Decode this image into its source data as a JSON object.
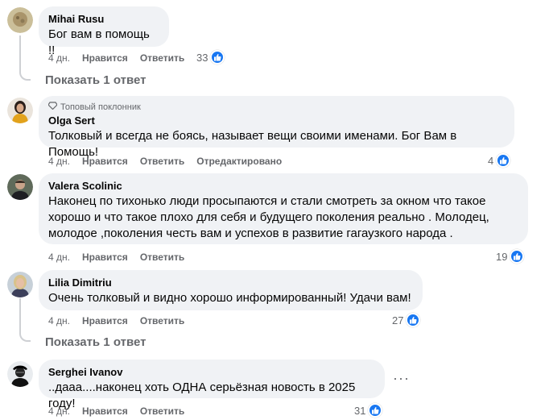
{
  "comments": [
    {
      "author": "Mihai Rusu",
      "text": "Бог вам в помощь !!",
      "time": "4 дн.",
      "like_label": "Нравится",
      "reply_label": "Ответить",
      "reactions": "33",
      "show_replies": "Показать 1 ответ"
    },
    {
      "badge": "Топовый поклонник",
      "author": "Olga Sert",
      "text": "Толковый и всегда не боясь, называет вещи своими именами. Бог Вам в Помощь!",
      "time": "4 дн.",
      "like_label": "Нравится",
      "reply_label": "Ответить",
      "edited_label": "Отредактировано",
      "reactions": "4"
    },
    {
      "author": "Valera Scolinic",
      "text_lines": [
        "Наконец по тихонько люди просыпаются и стали смотреть за окном что такое",
        "хорошо и что такое плохо для себя и будущего поколения реально . Молодец,",
        "молодое ,поколения честь вам и успехов в развитие гагаузкого народа ."
      ],
      "time": "4 дн.",
      "like_label": "Нравится",
      "reply_label": "Ответить",
      "reactions": "19"
    },
    {
      "author": "Lilia Dimitriu",
      "text": "Очень толковый и видно хорошо информированный! Удачи вам!",
      "time": "4 дн.",
      "like_label": "Нравится",
      "reply_label": "Ответить",
      "reactions": "27",
      "show_replies": "Показать 1 ответ"
    },
    {
      "author": "Serghei Ivanov",
      "text": "..дааа....наконец хоть ОДНА серьёзная новость в 2025 году!",
      "time": "4 дн.",
      "like_label": "Нравится",
      "reply_label": "Ответить",
      "reactions": "31",
      "more": "···"
    }
  ],
  "colors": {
    "like_blue": "#1877f2",
    "bubble": "#f0f2f5",
    "meta": "#65676b"
  }
}
